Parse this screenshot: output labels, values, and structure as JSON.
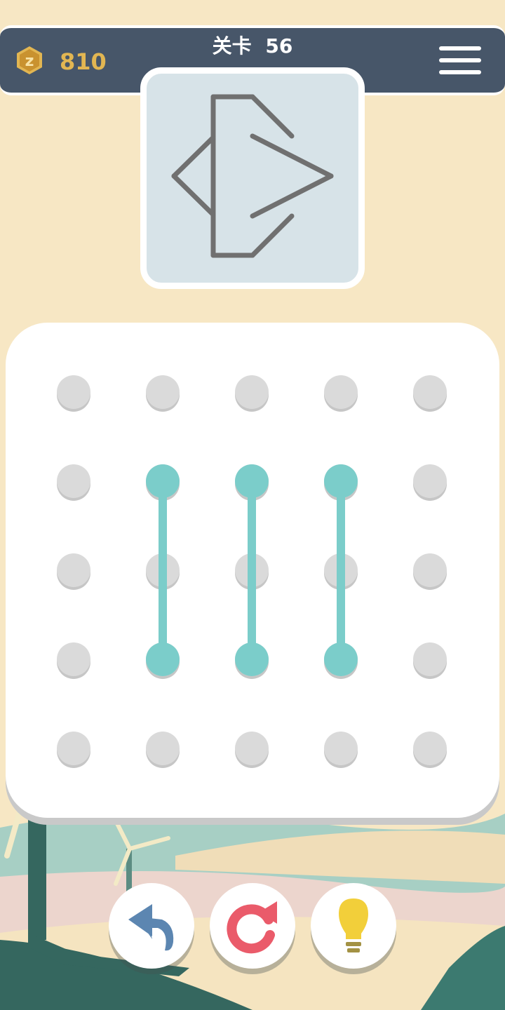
{
  "header": {
    "coins": "810",
    "level_label": "关卡",
    "level_number": "56",
    "icons": {
      "coin": "coin-z-icon",
      "menu": "hamburger-menu-icon"
    }
  },
  "target_shape": {
    "icon": "target-pattern-preview"
  },
  "board": {
    "rows": 5,
    "cols": 5,
    "connected_lines": [
      {
        "from": [
          1,
          1
        ],
        "to": [
          3,
          1
        ]
      },
      {
        "from": [
          1,
          2
        ],
        "to": [
          3,
          2
        ]
      },
      {
        "from": [
          1,
          3
        ],
        "to": [
          3,
          3
        ]
      }
    ]
  },
  "controls": {
    "undo": {
      "icon": "undo-arrow-icon"
    },
    "restart": {
      "icon": "restart-icon"
    },
    "hint": {
      "icon": "lightbulb-icon"
    }
  },
  "colors": {
    "background": "#f7e7c4",
    "header": "#475669",
    "coin_text": "#e2b652",
    "dot_inactive": "#dadada",
    "line_active": "#7bcdca",
    "target_stroke": "#707070"
  }
}
